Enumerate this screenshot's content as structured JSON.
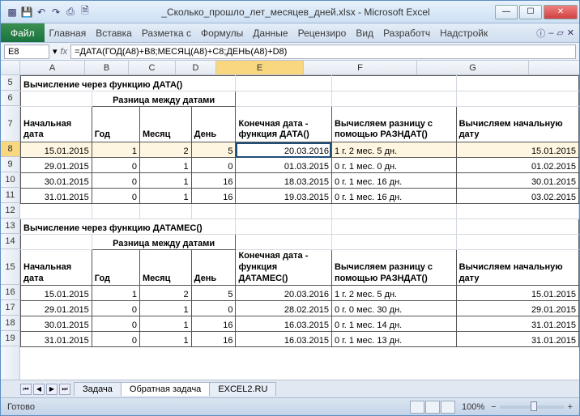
{
  "window": {
    "title": "_Сколько_прошло_лет_месяцев_дней.xlsx - Microsoft Excel",
    "qat_icons": [
      "excel-icon",
      "save-icon",
      "undo-icon",
      "redo-icon",
      "print-icon",
      "preview-icon"
    ]
  },
  "ribbon": {
    "file": "Файл",
    "tabs": [
      "Главная",
      "Вставка",
      "Разметка с",
      "Формулы",
      "Данные",
      "Рецензиро",
      "Вид",
      "Разработч",
      "Надстройк"
    ]
  },
  "formula_bar": {
    "name_box": "E8",
    "formula": "=ДАТА(ГОД(A8)+B8;МЕСЯЦ(A8)+C8;ДЕНЬ(A8)+D8)"
  },
  "columns": [
    "A",
    "B",
    "C",
    "D",
    "E",
    "F",
    "G"
  ],
  "selected_column": "E",
  "rows": [
    5,
    6,
    7,
    8,
    9,
    10,
    11,
    12,
    13,
    14,
    15,
    16,
    17,
    18,
    19
  ],
  "selected_row": 8,
  "section1": {
    "title": "Вычисление через функцию ДАТА()",
    "diff_header": "Разница между датами",
    "hdr": {
      "a": "Начальная дата",
      "b": "Год",
      "c": "Месяц",
      "d": "День",
      "e": "Конечная дата - функция ДАТА()",
      "f": "Вычисляем разницу с помощью РАЗНДАТ()",
      "g": "Вычисляем начальную дату"
    }
  },
  "data1": [
    {
      "a": "15.01.2015",
      "b": "1",
      "c": "2",
      "d": "5",
      "e": "20.03.2016",
      "f": "1 г. 2 мес. 5 дн.",
      "g": "15.01.2015"
    },
    {
      "a": "29.01.2015",
      "b": "0",
      "c": "1",
      "d": "0",
      "e": "01.03.2015",
      "f": "0 г. 1 мес. 0 дн.",
      "g": "01.02.2015"
    },
    {
      "a": "30.01.2015",
      "b": "0",
      "c": "1",
      "d": "16",
      "e": "18.03.2015",
      "f": "0 г. 1 мес. 16 дн.",
      "g": "30.01.2015"
    },
    {
      "a": "31.01.2015",
      "b": "0",
      "c": "1",
      "d": "16",
      "e": "19.03.2015",
      "f": "0 г. 1 мес. 16 дн.",
      "g": "03.02.2015"
    }
  ],
  "section2": {
    "title": "Вычисление через функцию ДАТАМЕС()",
    "diff_header": "Разница между датами",
    "hdr": {
      "a": "Начальная дата",
      "b": "Год",
      "c": "Месяц",
      "d": "День",
      "e": "Конечная дата - функция ДАТАМЕС()",
      "f": "Вычисляем разницу с помощью РАЗНДАТ()",
      "g": "Вычисляем начальную дату"
    }
  },
  "data2": [
    {
      "a": "15.01.2015",
      "b": "1",
      "c": "2",
      "d": "5",
      "e": "20.03.2016",
      "f": "1 г. 2 мес. 5 дн.",
      "g": "15.01.2015"
    },
    {
      "a": "29.01.2015",
      "b": "0",
      "c": "1",
      "d": "0",
      "e": "28.02.2015",
      "f": "0 г. 0 мес. 30 дн.",
      "g": "29.01.2015"
    },
    {
      "a": "30.01.2015",
      "b": "0",
      "c": "1",
      "d": "16",
      "e": "16.03.2015",
      "f": "0 г. 1 мес. 14 дн.",
      "g": "31.01.2015"
    },
    {
      "a": "31.01.2015",
      "b": "0",
      "c": "1",
      "d": "16",
      "e": "16.03.2015",
      "f": "0 г. 1 мес. 13 дн.",
      "g": "31.01.2015"
    }
  ],
  "sheet_tabs": {
    "items": [
      "Задача",
      "Обратная задача",
      "EXCEL2.RU"
    ],
    "active": 1
  },
  "status": {
    "ready": "Готово",
    "zoom": "100%",
    "zoom_minus": "−",
    "zoom_plus": "+"
  }
}
